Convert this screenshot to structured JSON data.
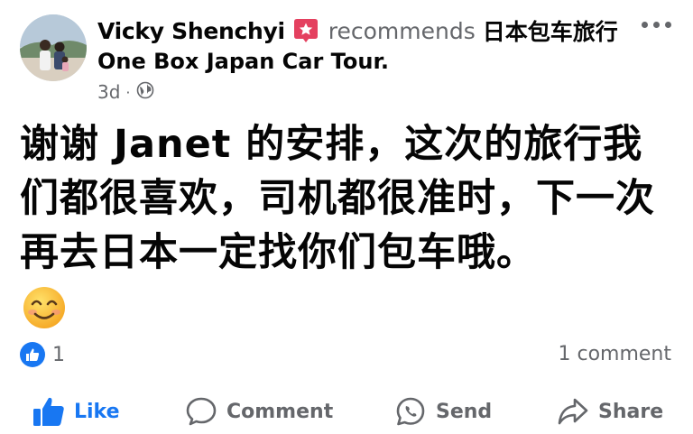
{
  "post": {
    "author_name": "Vicky Shenchyi",
    "action_text": "recommends",
    "page_name_cn": "日本包车旅行",
    "page_name_en": "One Box Japan Car Tour.",
    "time": "3d",
    "separator": "·",
    "privacy_icon": "globe-icon",
    "text": "谢谢 Janet 的安排，这次的旅行我们都很喜欢，司机都很准时，下一次再去日本一定找你们包车哦。",
    "emoji": "smiling-face-emoji"
  },
  "reactions": {
    "icon": "like-icon",
    "count": "1",
    "comments_label": "1 comment"
  },
  "actions": {
    "like_label": "Like",
    "comment_label": "Comment",
    "send_label": "Send",
    "share_label": "Share"
  },
  "colors": {
    "accent": "#1877f2",
    "badge": "#e4405f",
    "secondary_text": "#65676b",
    "primary_text": "#050505"
  }
}
